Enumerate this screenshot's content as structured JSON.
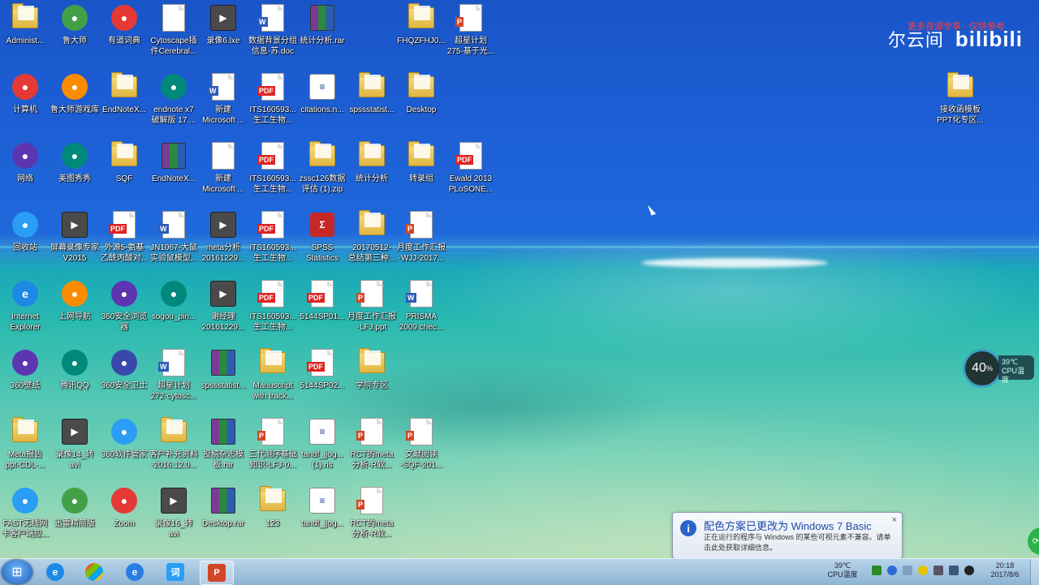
{
  "watermark": {
    "brand": "bilibili",
    "prefix": "尔云间",
    "red_text": "更多资源专享 - 仅供参考"
  },
  "desktop_icons": [
    {
      "label": "Administ...",
      "kind": "folder"
    },
    {
      "label": "鲁大师",
      "kind": "app"
    },
    {
      "label": "有道词典",
      "kind": "app"
    },
    {
      "label": "Cytoscape插\n件Cerebral...",
      "kind": "doc"
    },
    {
      "label": "录像6.lxe",
      "kind": "video"
    },
    {
      "label": "数据背景分组\n信息-苏.doc",
      "kind": "word"
    },
    {
      "label": "统计分析.rar",
      "kind": "rar"
    },
    {
      "label": "FHQZFHJ0...",
      "kind": "folder"
    },
    {
      "label": "超星计划\n275-基于光...",
      "kind": "ppt"
    },
    {
      "label": "计算机",
      "kind": "app"
    },
    {
      "label": "鲁大师游戏库",
      "kind": "app"
    },
    {
      "label": "EndNoteX...",
      "kind": "folder"
    },
    {
      "label": "endnote x7\n破解版 17....",
      "kind": "app"
    },
    {
      "label": "新建\nMicrosoft ...",
      "kind": "word"
    },
    {
      "label": "ITS160593...\n生工生物...",
      "kind": "pdf"
    },
    {
      "label": "citations.n...",
      "kind": "ris"
    },
    {
      "label": "spssstatist...",
      "kind": "folder"
    },
    {
      "label": "Desktop",
      "kind": "folder"
    },
    {
      "label": "网络",
      "kind": "app"
    },
    {
      "label": "美图秀秀",
      "kind": "app"
    },
    {
      "label": "SQF",
      "kind": "folder"
    },
    {
      "label": "EndNoteX...",
      "kind": "rar"
    },
    {
      "label": "新建\nMicrosoft ...",
      "kind": "doc"
    },
    {
      "label": "ITS160593...\n生工生物...",
      "kind": "pdf"
    },
    {
      "label": "zssc126数据\n评估 (1).zip",
      "kind": "folder"
    },
    {
      "label": "统计分析",
      "kind": "folder"
    },
    {
      "label": "转录组",
      "kind": "folder"
    },
    {
      "label": "Ewald 2013\nPLoSONE...",
      "kind": "pdf"
    },
    {
      "label": "回收站",
      "kind": "app"
    },
    {
      "label": "屏幕录像专家\nV2015",
      "kind": "video"
    },
    {
      "label": "外源5-氨基\n乙酰丙酸对...",
      "kind": "pdf"
    },
    {
      "label": "JN1067-大鼠\n实验鼠模型...",
      "kind": "word"
    },
    {
      "label": "meta分析\n20161229...",
      "kind": "video"
    },
    {
      "label": "ITS160593...\n生工生物...",
      "kind": "pdf"
    },
    {
      "label": "SPSS\nStatistics",
      "kind": "spss"
    },
    {
      "label": "20170512-\n总结第三种...",
      "kind": "folder"
    },
    {
      "label": "月度工作汇报\n-WJJ-2017...",
      "kind": "ppt"
    },
    {
      "label": "Internet\nExplorer",
      "kind": "ie"
    },
    {
      "label": "上网导航",
      "kind": "app"
    },
    {
      "label": "360安全浏览\n器",
      "kind": "app"
    },
    {
      "label": "sogou_pin...",
      "kind": "app"
    },
    {
      "label": "谢经理\n20161229...",
      "kind": "video"
    },
    {
      "label": "ITS160593...\n生工生物...",
      "kind": "pdf"
    },
    {
      "label": "5144SP01...",
      "kind": "pdf"
    },
    {
      "label": "月度工作汇报\n-LFJ.ppt",
      "kind": "ppt"
    },
    {
      "label": "PRISMA\n2009 chec...",
      "kind": "word"
    },
    {
      "label": "360壁纸",
      "kind": "app"
    },
    {
      "label": "腾讯QQ",
      "kind": "app"
    },
    {
      "label": "360安全卫士",
      "kind": "app"
    },
    {
      "label": "超星计划\n272-cytosc...",
      "kind": "word"
    },
    {
      "label": "spssstatist...",
      "kind": "rar"
    },
    {
      "label": "Manuscript\nwith track...",
      "kind": "folder"
    },
    {
      "label": "5144SP02...",
      "kind": "pdf"
    },
    {
      "label": "学院专区",
      "kind": "folder"
    },
    {
      "label": "Meta报告\nppt-CDL-...",
      "kind": "folder"
    },
    {
      "label": "录像14_转\navi",
      "kind": "video"
    },
    {
      "label": "360软件管家",
      "kind": "app"
    },
    {
      "label": "客户补充资料\n-2016.12.0...",
      "kind": "folder"
    },
    {
      "label": "投稿杂志模\n板.rar",
      "kind": "rar"
    },
    {
      "label": "三代测序基础\n知识-LFJ-0...",
      "kind": "ppt"
    },
    {
      "label": "tandf_jjog...\n(1).ris",
      "kind": "ris"
    },
    {
      "label": "RCT的meta\n分析-R软...",
      "kind": "ppt"
    },
    {
      "label": "文献阅读\n-SQF-201...",
      "kind": "ppt"
    },
    {
      "label": "FAST无线网\n卡客户端应...",
      "kind": "app"
    },
    {
      "label": "迅雷精简版",
      "kind": "app"
    },
    {
      "label": "Zoom",
      "kind": "app"
    },
    {
      "label": "录像16_转\navi",
      "kind": "video"
    },
    {
      "label": "Desktop.rar",
      "kind": "rar"
    },
    {
      "label": "123",
      "kind": "folder"
    },
    {
      "label": "tandf_jjog...",
      "kind": "ris"
    },
    {
      "label": "RCT的meta\n分析-R软...",
      "kind": "ppt"
    },
    {
      "label": "接收函模板\nPPT化专区...",
      "kind": "folder"
    }
  ],
  "cpu_widget": {
    "percent": "40",
    "percent_unit": "%",
    "temp": "39℃",
    "temp_label": "CPU温度"
  },
  "balloon": {
    "title": "配色方案已更改为 Windows 7 Basic",
    "body": "正在运行的程序与 Windows 的某些可视元素不兼容。请单击此处获取详细信息。",
    "close": "×"
  },
  "taskbar": {
    "temp": "39℃",
    "temp_label": "CPU温度",
    "time": "20:18",
    "date": "2017/8/6"
  }
}
